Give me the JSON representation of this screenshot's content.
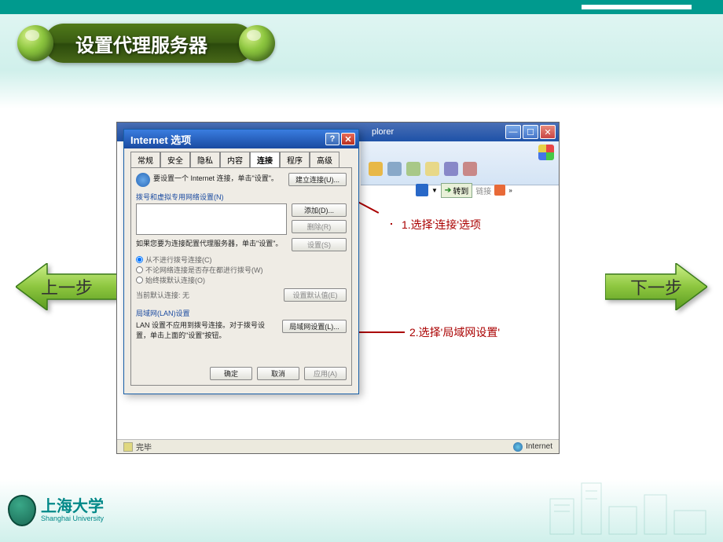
{
  "slide": {
    "title": "设置代理服务器"
  },
  "nav": {
    "prev": "上一步",
    "next": "下一步"
  },
  "browser": {
    "title_fragment": "plorer",
    "go_label": "转到",
    "links_label": "链接",
    "status_done": "完毕",
    "status_zone": "Internet"
  },
  "dialog": {
    "title": "Internet 选项",
    "tabs": [
      "常规",
      "安全",
      "隐私",
      "内容",
      "连接",
      "程序",
      "高级"
    ],
    "active_tab": "连接",
    "setup_text": "要设置一个 Internet 连接，单击\"设置\"。",
    "setup_btn": "建立连接(U)...",
    "dialup_header": "拨号和虚拟专用网络设置(N)",
    "add_btn": "添加(D)...",
    "remove_btn": "删除(R)",
    "proxy_hint": "如果您要为连接配置代理服务器，单击\"设置\"。",
    "settings_btn": "设置(S)",
    "radio1": "从不进行拨号连接(C)",
    "radio2": "不论网络连接是否存在都进行拨号(W)",
    "radio3": "始终拨默认连接(O)",
    "default_label": "当前默认连接:  无",
    "set_default_btn": "设置默认值(E)",
    "lan_header": "局域网(LAN)设置",
    "lan_hint": "LAN 设置不应用到拨号连接。对于拨号设置，单击上面的\"设置\"按钮。",
    "lan_btn": "局域网设置(L)...",
    "ok": "确定",
    "cancel": "取消",
    "apply": "应用(A)"
  },
  "annot": {
    "step1": "1.选择'连接'选项",
    "step2": "2.选择'局域网设置'"
  },
  "logo": {
    "cn": "上海大学",
    "en": "Shanghai University"
  }
}
